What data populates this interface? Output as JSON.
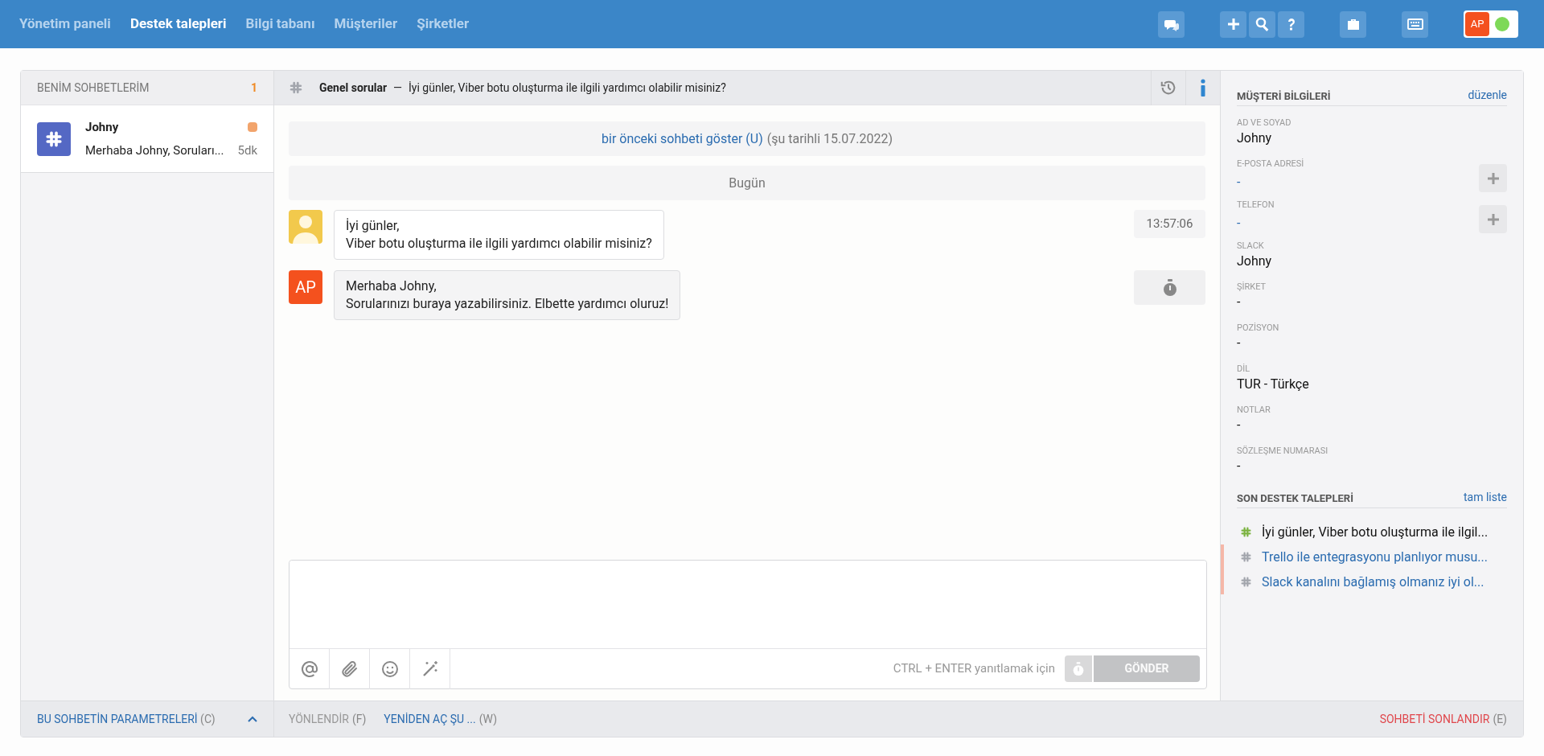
{
  "nav": [
    {
      "label": "Yönetim paneli",
      "selected": false
    },
    {
      "label": "Destek talepleri",
      "selected": true
    },
    {
      "label": "Bilgi tabanı",
      "selected": false
    },
    {
      "label": "Müşteriler",
      "selected": false
    },
    {
      "label": "Şirketler",
      "selected": false
    }
  ],
  "toolbar": [
    {
      "kind": "chat"
    },
    {
      "kind": "plus"
    },
    {
      "kind": "search"
    },
    {
      "kind": "help"
    },
    {
      "kind": "briefcase"
    },
    {
      "kind": "keyboard"
    }
  ],
  "user": {
    "initials": "AP",
    "online": true
  },
  "sidebar": {
    "title": "BENİM SOHBETLERİM",
    "count": "1",
    "chats": [
      {
        "name": "Johny",
        "preview": "Merhaba Johny, Soruları...",
        "time": "5dk",
        "selected": true,
        "unread": true
      }
    ]
  },
  "conversation": {
    "channel": "Genel sorular",
    "separator": "—",
    "subject": "İyi günler, Viber botu oluşturma ile ilgili yardımcı olabilir misiniz?",
    "previous": {
      "link": "bir önceki sohbeti göster (U)",
      "note": "(şu tarihli 15.07.2022)"
    },
    "day": "Bugün",
    "messages": [
      {
        "kind": "customer",
        "lines": [
          "İyi günler,",
          "Viber botu oluşturma ile ilgili yardımcı olabilir misiniz?"
        ],
        "time": "13:57:06"
      },
      {
        "kind": "agent",
        "initials": "AP",
        "lines": [
          "Merhaba Johny,",
          "Sorularınızı buraya yazabilirsiniz. Elbette yardımcı oluruz!"
        ]
      }
    ],
    "composer": {
      "hint": "CTRL + ENTER yanıtlamak için",
      "send": "GÖNDER",
      "send_disabled": true
    }
  },
  "customer": {
    "title": "MÜŞTERİ BİLGİLERİ",
    "edit": "düzenle",
    "fields": [
      {
        "label": "AD VE SOYAD",
        "value": "Johny",
        "kind": "text",
        "addable": false
      },
      {
        "label": "E-POSTA ADRESİ",
        "value": "-",
        "kind": "link",
        "addable": true
      },
      {
        "label": "TELEFON",
        "value": "-",
        "kind": "link",
        "addable": true
      },
      {
        "label": "SLACK",
        "value": "Johny",
        "kind": "text",
        "addable": false
      },
      {
        "label": "ŞİRKET",
        "value": "-",
        "kind": "text",
        "addable": false
      },
      {
        "label": "POZİSYON",
        "value": "-",
        "kind": "text",
        "addable": false
      },
      {
        "label": "DİL",
        "value": "TUR - Türkçe",
        "kind": "text",
        "addable": false
      },
      {
        "label": "NOTLAR",
        "value": "-",
        "kind": "text",
        "addable": false
      },
      {
        "label": "SÖZLEŞME NUMARASI",
        "value": "-",
        "kind": "text",
        "addable": false
      }
    ]
  },
  "recent": {
    "title": "SON DESTEK TALEPLERİ",
    "link": "tam liste",
    "items": [
      {
        "text": "İyi günler, Viber botu oluşturma ile ilgil...",
        "current": true,
        "flagged": false
      },
      {
        "text": "Trello ile entegrasyonu planlıyor musu...",
        "current": false,
        "flagged": true
      },
      {
        "text": "Slack kanalını bağlamış olmanız iyi ol...",
        "current": false,
        "flagged": true
      }
    ]
  },
  "footer": {
    "params": {
      "label": "BU SOHBETİN PARAMETRELERİ",
      "key": "(C)"
    },
    "actions": [
      {
        "label": "YÖNLENDİR",
        "key": "(F)",
        "kind": "disabled"
      },
      {
        "label": "YENİDEN AÇ ŞU ...",
        "key": "(W)",
        "kind": "link"
      }
    ],
    "end": {
      "label": "SOHBETİ SONLANDIR",
      "key": "(E)"
    }
  }
}
